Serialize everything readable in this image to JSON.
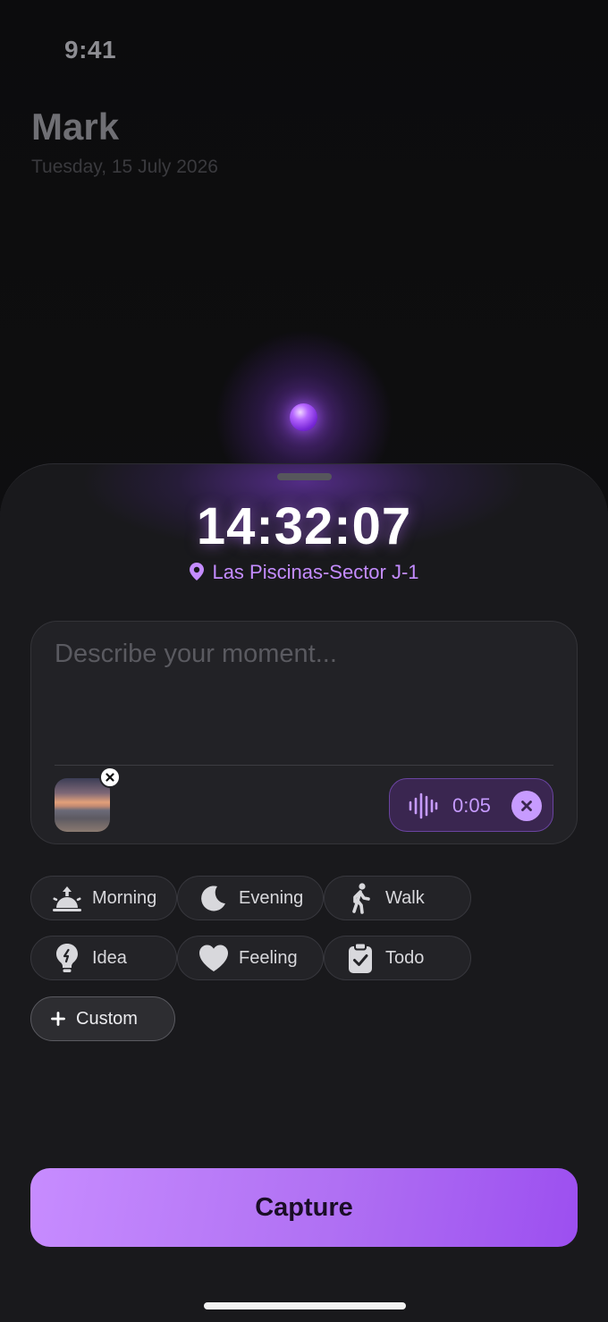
{
  "status": {
    "time": "9:41"
  },
  "background": {
    "title": "Mark",
    "date": "Tuesday, 15 July 2026"
  },
  "capture_sheet": {
    "clock": "14:32:07",
    "location": "Las Piscinas-Sector J-1",
    "note": {
      "placeholder": "Describe your moment...",
      "value": ""
    },
    "attachments": {
      "photo": {
        "icon": "remove-photo-icon"
      },
      "audio": {
        "duration": "0:05",
        "icon": "waveform-icon",
        "remove_icon": "close-icon"
      }
    },
    "tags": [
      {
        "label": "Morning",
        "icon": "sunrise-icon"
      },
      {
        "label": "Evening",
        "icon": "moon-icon"
      },
      {
        "label": "Walk",
        "icon": "walking-icon"
      },
      {
        "label": "Idea",
        "icon": "lightbulb-icon"
      },
      {
        "label": "Feeling",
        "icon": "heart-icon"
      },
      {
        "label": "Todo",
        "icon": "clipboard-check-icon"
      }
    ],
    "custom_tag": {
      "label": "Custom",
      "icon": "plus-icon"
    },
    "capture_button": {
      "label": "Capture"
    }
  },
  "colors": {
    "accent": "#b070f3",
    "location": "#c48cff",
    "sheet": "#19191c",
    "background": "#0d0d0f"
  }
}
